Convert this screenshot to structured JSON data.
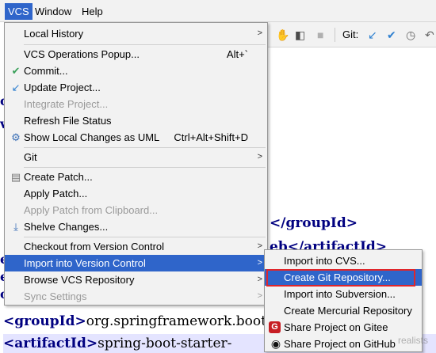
{
  "menubar": {
    "vcs": "VCS",
    "window": "Window",
    "help": "Help"
  },
  "toolbar": {
    "git_label": "Git:"
  },
  "editor": {
    "line_group_close": "</groupId>",
    "line_artifact_frag": "eb</artifactId>",
    "group_open": "<groupId>",
    "group_value": "org.springframework.boot",
    "artifact_open": "<artifactId>",
    "artifact_value": "spring-boot-starter-",
    "gutter": [
      "c",
      "v",
      "e",
      "e",
      "o"
    ]
  },
  "vcs_menu": {
    "items": [
      {
        "label": "Local History",
        "arrow": true
      },
      {
        "label": "VCS Operations Popup...",
        "shortcut": "Alt+`"
      },
      {
        "label": "Commit...",
        "icon": "✔"
      },
      {
        "label": "Update Project...",
        "icon": "↙"
      },
      {
        "label": "Integrate Project...",
        "disabled": true
      },
      {
        "label": "Refresh File Status"
      },
      {
        "label": "Show Local Changes as UML",
        "shortcut": "Ctrl+Alt+Shift+D"
      },
      {
        "label": "Git",
        "arrow": true
      },
      {
        "label": "Create Patch..."
      },
      {
        "label": "Apply Patch..."
      },
      {
        "label": "Apply Patch from Clipboard...",
        "disabled": true
      },
      {
        "label": "Shelve Changes..."
      },
      {
        "label": "Checkout from Version Control",
        "arrow": true
      },
      {
        "label": "Import into Version Control",
        "arrow": true
      },
      {
        "label": "Browse VCS Repository",
        "arrow": true
      },
      {
        "label": "Sync Settings",
        "disabled": true,
        "arrow": true
      }
    ]
  },
  "import_submenu": {
    "items": [
      {
        "label": "Import into CVS..."
      },
      {
        "label": "Create Git Repository..."
      },
      {
        "label": "Import into Subversion..."
      },
      {
        "label": "Create Mercurial Repository"
      },
      {
        "label": "Share Project on Gitee"
      },
      {
        "label": "Share Project on GitHub"
      }
    ]
  },
  "watermark": "realists"
}
